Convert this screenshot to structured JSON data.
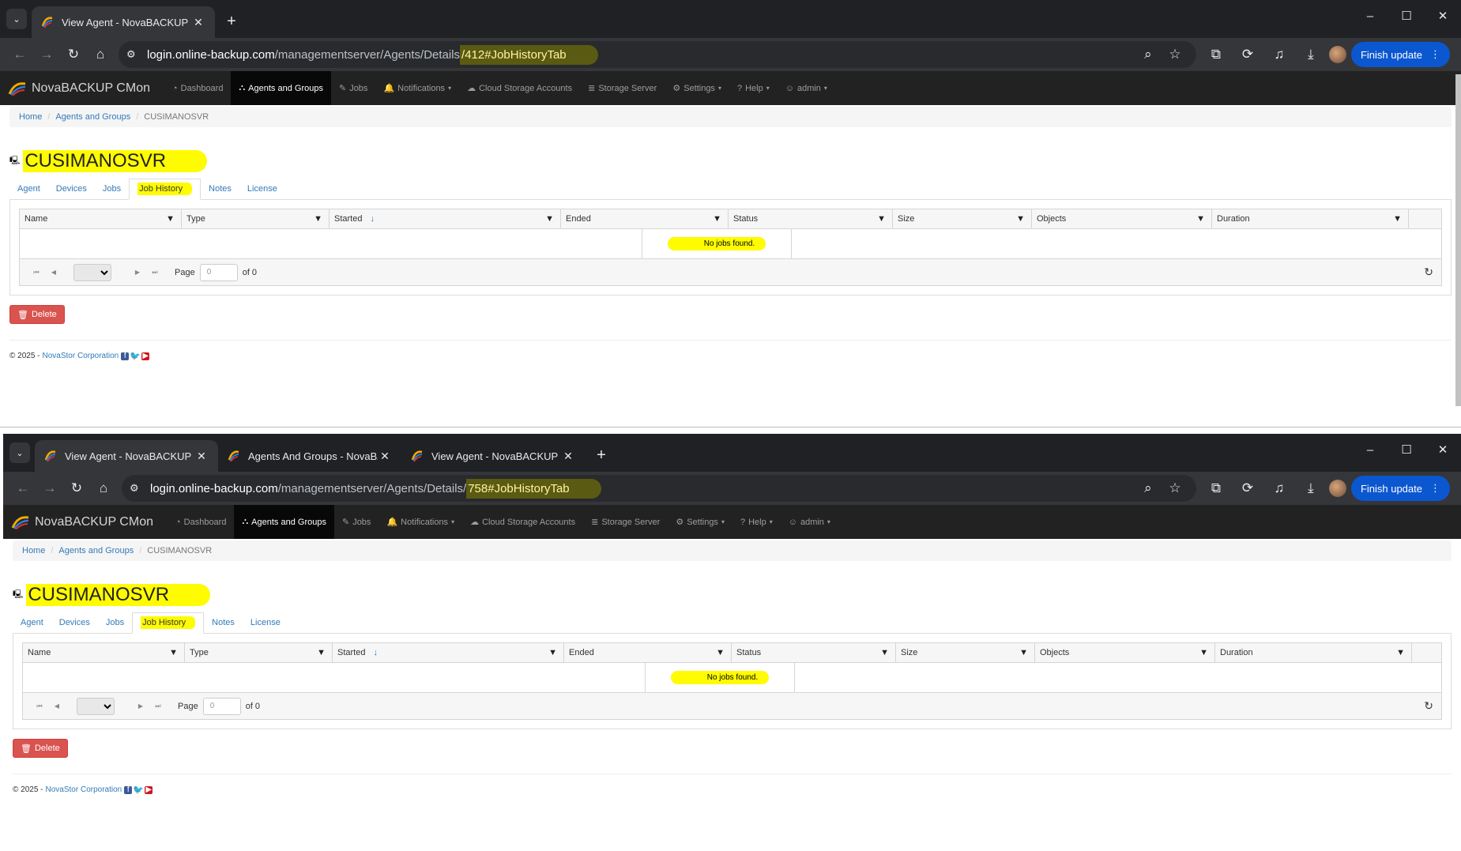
{
  "windows": [
    {
      "tabs": [
        {
          "title": "View Agent - NovaBACKUP CMon",
          "active": true
        }
      ],
      "new_tab": "+",
      "controls": {
        "minimize": "–",
        "maximize": "☐",
        "close": "✕"
      },
      "url": {
        "host": "login.online-backup.com",
        "path": "/managementserver/Agents/Details",
        "highlight": "/412#JobHistoryTab"
      },
      "finish_update": "Finish update",
      "navbar": {
        "brand": "NovaBACKUP CMon",
        "items": [
          {
            "icon": "◔",
            "label": "Dashboard",
            "active": false
          },
          {
            "icon": "⛬",
            "label": "Agents and Groups",
            "active": true
          },
          {
            "icon": "✎",
            "label": "Jobs",
            "active": false
          },
          {
            "icon": "🔔",
            "label": "Notifications",
            "active": false,
            "caret": true
          },
          {
            "icon": "☁",
            "label": "Cloud Storage Accounts",
            "active": false
          },
          {
            "icon": "≣",
            "label": "Storage Server",
            "active": false
          },
          {
            "icon": "⚙",
            "label": "Settings",
            "active": false,
            "caret": true
          },
          {
            "icon": "?",
            "label": "Help",
            "active": false,
            "caret": true
          },
          {
            "icon": "☺",
            "label": "admin",
            "active": false,
            "caret": true
          }
        ]
      },
      "breadcrumb": [
        "Home",
        "Agents and Groups",
        "CUSIMANOSVR"
      ],
      "page_title": "CUSIMANOSVR",
      "detail_tabs": [
        "Agent",
        "Devices",
        "Jobs",
        "Job History",
        "Notes",
        "License"
      ],
      "active_detail_tab": "Job History",
      "grid": {
        "columns": [
          "Name",
          "Type",
          "Started",
          "Ended",
          "Status",
          "Size",
          "Objects",
          "Duration"
        ],
        "empty_message": "No jobs found.",
        "pager": {
          "page_label": "Page",
          "page_value": "0",
          "of_label": "of 0"
        }
      },
      "delete_label": "Delete",
      "footer": {
        "copyright": "© 2025 -",
        "company": "NovaStor Corporation"
      }
    },
    {
      "tabs": [
        {
          "title": "View Agent - NovaBACKUP CMon",
          "active": true
        },
        {
          "title": "Agents And Groups - NovaBACKUP",
          "active": false
        },
        {
          "title": "View Agent - NovaBACKUP CMon",
          "active": false
        }
      ],
      "new_tab": "+",
      "controls": {
        "minimize": "–",
        "maximize": "☐",
        "close": "✕"
      },
      "url": {
        "host": "login.online-backup.com",
        "path": "/managementserver/Agents/Details/",
        "highlight": "758#JobHistoryTab"
      },
      "finish_update": "Finish update",
      "navbar": {
        "brand": "NovaBACKUP CMon",
        "items": [
          {
            "icon": "◔",
            "label": "Dashboard",
            "active": false
          },
          {
            "icon": "⛬",
            "label": "Agents and Groups",
            "active": true
          },
          {
            "icon": "✎",
            "label": "Jobs",
            "active": false
          },
          {
            "icon": "🔔",
            "label": "Notifications",
            "active": false,
            "caret": true
          },
          {
            "icon": "☁",
            "label": "Cloud Storage Accounts",
            "active": false
          },
          {
            "icon": "≣",
            "label": "Storage Server",
            "active": false
          },
          {
            "icon": "⚙",
            "label": "Settings",
            "active": false,
            "caret": true
          },
          {
            "icon": "?",
            "label": "Help",
            "active": false,
            "caret": true
          },
          {
            "icon": "☺",
            "label": "admin",
            "active": false,
            "caret": true
          }
        ]
      },
      "breadcrumb": [
        "Home",
        "Agents and Groups",
        "CUSIMANOSVR"
      ],
      "page_title": "CUSIMANOSVR",
      "detail_tabs": [
        "Agent",
        "Devices",
        "Jobs",
        "Job History",
        "Notes",
        "License"
      ],
      "active_detail_tab": "Job History",
      "grid": {
        "columns": [
          "Name",
          "Type",
          "Started",
          "Ended",
          "Status",
          "Size",
          "Objects",
          "Duration"
        ],
        "empty_message": "No jobs found.",
        "pager": {
          "page_label": "Page",
          "page_value": "0",
          "of_label": "of 0"
        }
      },
      "delete_label": "Delete",
      "footer": {
        "copyright": "© 2025 -",
        "company": "NovaStor Corporation"
      }
    }
  ]
}
